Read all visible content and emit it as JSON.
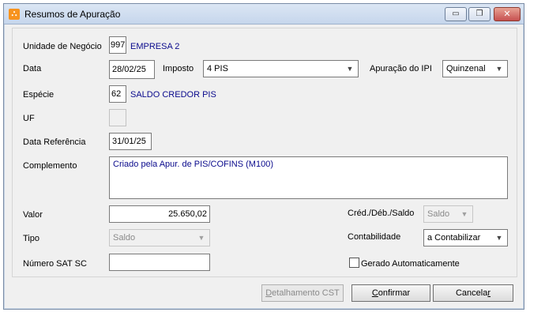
{
  "window": {
    "title": "Resumos de Apuração",
    "icon": "app-logo-icon",
    "minimize_glyph": "▭",
    "restore_glyph": "❐",
    "close_glyph": "✕"
  },
  "form": {
    "unidade_label": "Unidade de Negócio",
    "unidade_code": "997",
    "unidade_name": "EMPRESA 2",
    "data_label": "Data",
    "data_value": "28/02/25",
    "imposto_label": "Imposto",
    "imposto_value": "4 PIS",
    "apuracao_label": "Apuração do IPI",
    "apuracao_value": "Quinzenal",
    "especie_label": "Espécie",
    "especie_code": "62",
    "especie_name": "SALDO CREDOR PIS",
    "uf_label": "UF",
    "uf_value": "",
    "data_ref_label": "Data Referência",
    "data_ref_value": "31/01/25",
    "complemento_label": "Complemento",
    "complemento_value": "Criado pela Apur. de PIS/COFINS (M100)",
    "valor_label": "Valor",
    "valor_value": "25.650,02",
    "cred_deb_label": "Créd./Déb./Saldo",
    "cred_deb_value": "Saldo",
    "tipo_label": "Tipo",
    "tipo_value": "Saldo",
    "contabilidade_label": "Contabilidade",
    "contabilidade_value": "a Contabilizar",
    "numero_sat_label": "Número SAT SC",
    "numero_sat_value": "",
    "gerado_label": "Gerado Automaticamente",
    "gerado_checked": false
  },
  "buttons": {
    "detalhamento_pre": "",
    "detalhamento_key": "D",
    "detalhamento_post": "etalhamento CST",
    "confirmar_pre": "",
    "confirmar_key": "C",
    "confirmar_post": "onfirmar",
    "cancelar_pre": "Cancela",
    "cancelar_key": "r",
    "cancelar_post": ""
  }
}
